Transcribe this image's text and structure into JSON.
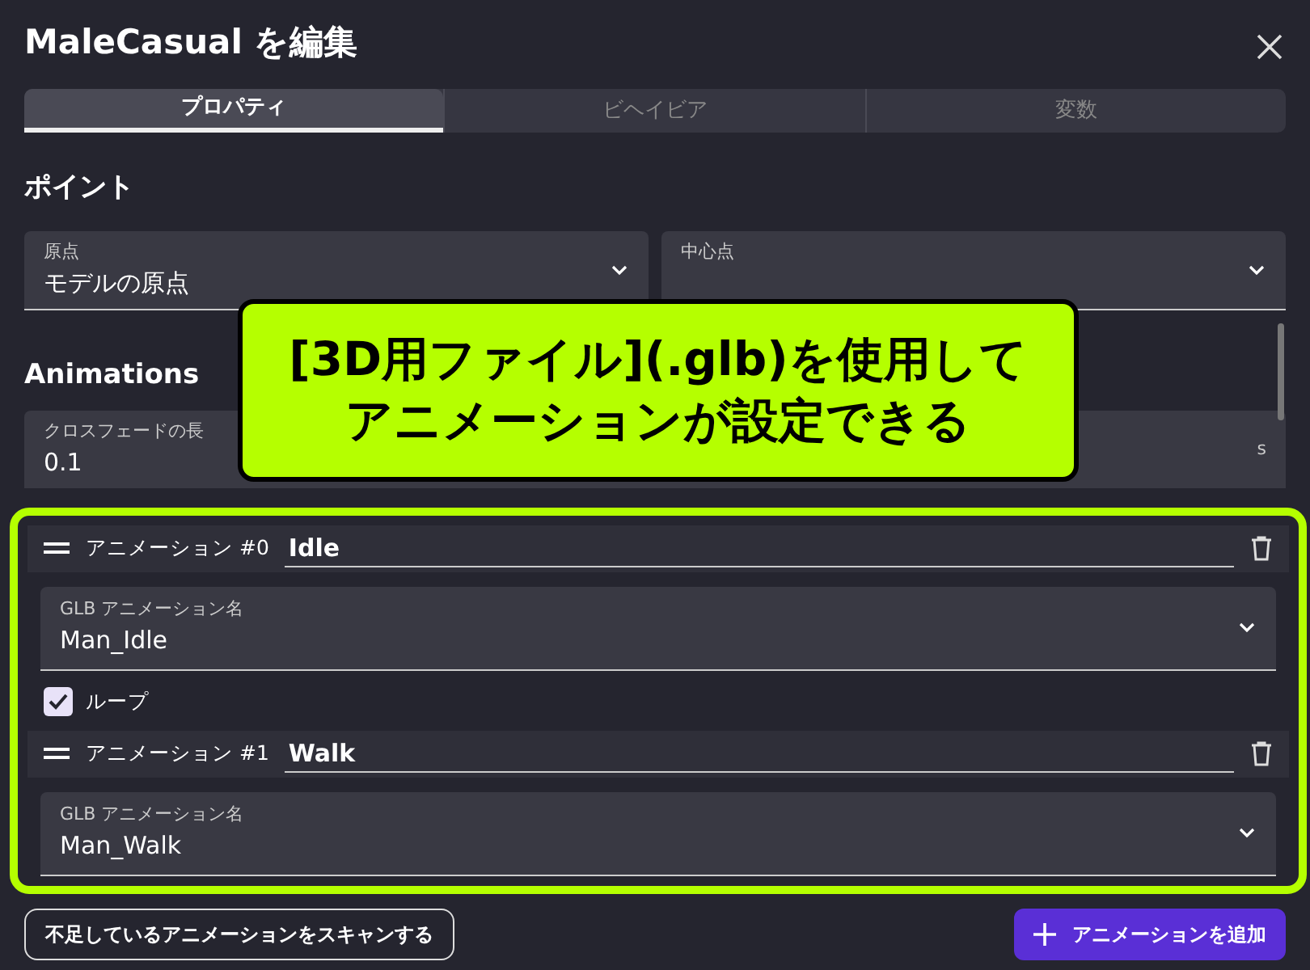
{
  "dialog": {
    "title": "MaleCasual を編集"
  },
  "tabs": [
    {
      "label": "プロパティ",
      "selected": true
    },
    {
      "label": "ビヘイビア",
      "selected": false
    },
    {
      "label": "変数",
      "selected": false
    }
  ],
  "points": {
    "heading": "ポイント",
    "selects": [
      {
        "label": "原点",
        "value": "モデルの原点"
      },
      {
        "label": "中心点"
      }
    ]
  },
  "animations": {
    "heading": "Animations",
    "crossfade": {
      "label": "クロスフェードの長",
      "value": "0.1",
      "unit": "s"
    },
    "items": [
      {
        "label": "アニメーション #0",
        "name": "Idle",
        "glb_label": "GLB アニメーション名",
        "glb_value": "Man_Idle",
        "loop": {
          "label": "ループ",
          "checked": true
        }
      },
      {
        "label": "アニメーション #1",
        "name": "Walk",
        "glb_label": "GLB アニメーション名",
        "glb_value": "Man_Walk"
      }
    ]
  },
  "callout": {
    "lines": [
      "[3D用ファイル](.glb)を使用して",
      "アニメーションが設定できる"
    ]
  },
  "buttons": [
    {
      "kind": "outline",
      "label": "不足しているアニメーションをスキャンする"
    },
    {
      "kind": "primary",
      "label": "アニメーションを追加"
    }
  ]
}
